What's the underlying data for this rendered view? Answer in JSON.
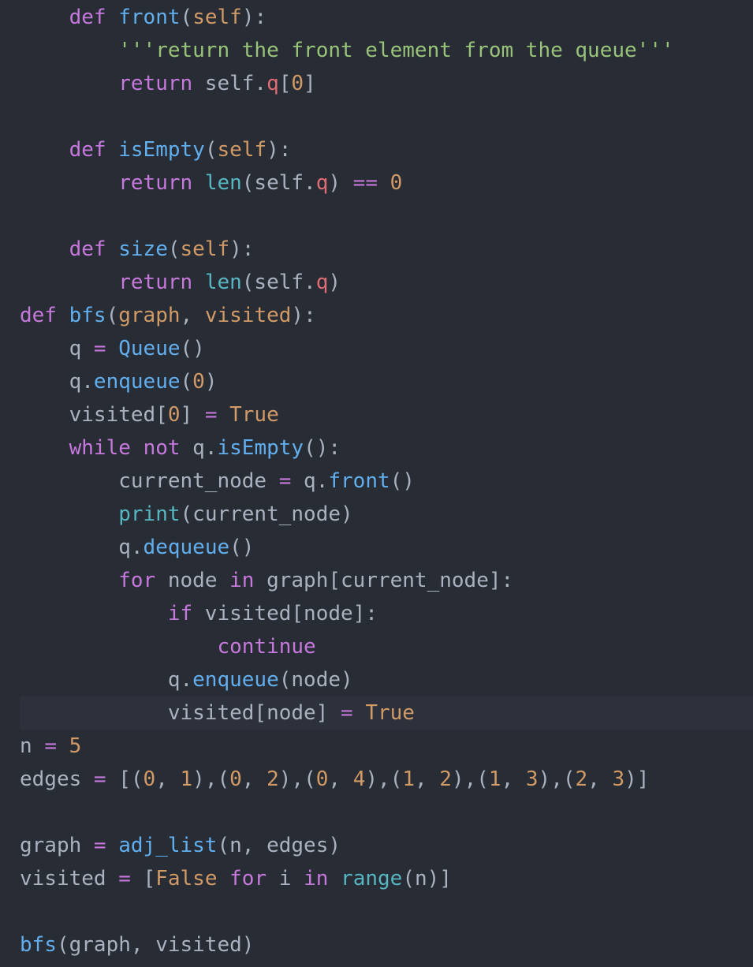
{
  "editor": {
    "language": "python",
    "theme": "one-dark",
    "background_color": "#282c34",
    "active_line_color": "#2c313c",
    "default_text_color": "#abb2bf",
    "font_size_px": 26,
    "line_height_px": 42,
    "active_line_number": 18,
    "palette": {
      "keyword": "#c678dd",
      "function": "#61afef",
      "parameter": "#d19a66",
      "builtin": "#56b6c2",
      "number": "#d19a66",
      "constant": "#d19a66",
      "string": "#98c379",
      "attribute": "#e06c75",
      "operator": "#c678dd",
      "plain": "#abb2bf"
    }
  },
  "code": {
    "lines": [
      {
        "n": 1,
        "text": "    def front(self):",
        "tokens": [
          {
            "t": "    ",
            "c": "plain"
          },
          {
            "t": "def",
            "c": "keyword"
          },
          {
            "t": " ",
            "c": "plain"
          },
          {
            "t": "front",
            "c": "function"
          },
          {
            "t": "(",
            "c": "plain"
          },
          {
            "t": "self",
            "c": "parameter"
          },
          {
            "t": "):",
            "c": "plain"
          }
        ]
      },
      {
        "n": 2,
        "text": "        '''return the front element from the queue'''",
        "tokens": [
          {
            "t": "        ",
            "c": "plain"
          },
          {
            "t": "'''return the front element from the queue'''",
            "c": "string"
          }
        ]
      },
      {
        "n": 3,
        "text": "        return self.q[0]",
        "tokens": [
          {
            "t": "        ",
            "c": "plain"
          },
          {
            "t": "return",
            "c": "keyword"
          },
          {
            "t": " self.",
            "c": "plain"
          },
          {
            "t": "q",
            "c": "attribute"
          },
          {
            "t": "[",
            "c": "plain"
          },
          {
            "t": "0",
            "c": "number"
          },
          {
            "t": "]",
            "c": "plain"
          }
        ]
      },
      {
        "n": 4,
        "text": "",
        "tokens": []
      },
      {
        "n": 5,
        "text": "    def isEmpty(self):",
        "tokens": [
          {
            "t": "    ",
            "c": "plain"
          },
          {
            "t": "def",
            "c": "keyword"
          },
          {
            "t": " ",
            "c": "plain"
          },
          {
            "t": "isEmpty",
            "c": "function"
          },
          {
            "t": "(",
            "c": "plain"
          },
          {
            "t": "self",
            "c": "parameter"
          },
          {
            "t": "):",
            "c": "plain"
          }
        ]
      },
      {
        "n": 6,
        "text": "        return len(self.q) == 0",
        "tokens": [
          {
            "t": "        ",
            "c": "plain"
          },
          {
            "t": "return",
            "c": "keyword"
          },
          {
            "t": " ",
            "c": "plain"
          },
          {
            "t": "len",
            "c": "builtin"
          },
          {
            "t": "(self.",
            "c": "plain"
          },
          {
            "t": "q",
            "c": "attribute"
          },
          {
            "t": ") ",
            "c": "plain"
          },
          {
            "t": "==",
            "c": "operator"
          },
          {
            "t": " ",
            "c": "plain"
          },
          {
            "t": "0",
            "c": "number"
          }
        ]
      },
      {
        "n": 7,
        "text": "",
        "tokens": []
      },
      {
        "n": 8,
        "text": "    def size(self):",
        "tokens": [
          {
            "t": "    ",
            "c": "plain"
          },
          {
            "t": "def",
            "c": "keyword"
          },
          {
            "t": " ",
            "c": "plain"
          },
          {
            "t": "size",
            "c": "function"
          },
          {
            "t": "(",
            "c": "plain"
          },
          {
            "t": "self",
            "c": "parameter"
          },
          {
            "t": "):",
            "c": "plain"
          }
        ]
      },
      {
        "n": 9,
        "text": "        return len(self.q)",
        "tokens": [
          {
            "t": "        ",
            "c": "plain"
          },
          {
            "t": "return",
            "c": "keyword"
          },
          {
            "t": " ",
            "c": "plain"
          },
          {
            "t": "len",
            "c": "builtin"
          },
          {
            "t": "(self.",
            "c": "plain"
          },
          {
            "t": "q",
            "c": "attribute"
          },
          {
            "t": ")",
            "c": "plain"
          }
        ]
      },
      {
        "n": 10,
        "text": "def bfs(graph, visited):",
        "tokens": [
          {
            "t": "def",
            "c": "keyword"
          },
          {
            "t": " ",
            "c": "plain"
          },
          {
            "t": "bfs",
            "c": "function"
          },
          {
            "t": "(",
            "c": "plain"
          },
          {
            "t": "graph",
            "c": "parameter"
          },
          {
            "t": ", ",
            "c": "plain"
          },
          {
            "t": "visited",
            "c": "parameter"
          },
          {
            "t": "):",
            "c": "plain"
          }
        ]
      },
      {
        "n": 11,
        "text": "    q = Queue()",
        "tokens": [
          {
            "t": "    q ",
            "c": "plain"
          },
          {
            "t": "=",
            "c": "operator"
          },
          {
            "t": " ",
            "c": "plain"
          },
          {
            "t": "Queue",
            "c": "function"
          },
          {
            "t": "()",
            "c": "plain"
          }
        ]
      },
      {
        "n": 12,
        "text": "    q.enqueue(0)",
        "tokens": [
          {
            "t": "    q.",
            "c": "plain"
          },
          {
            "t": "enqueue",
            "c": "function"
          },
          {
            "t": "(",
            "c": "plain"
          },
          {
            "t": "0",
            "c": "number"
          },
          {
            "t": ")",
            "c": "plain"
          }
        ]
      },
      {
        "n": 13,
        "text": "    visited[0] = True",
        "tokens": [
          {
            "t": "    visited[",
            "c": "plain"
          },
          {
            "t": "0",
            "c": "number"
          },
          {
            "t": "] ",
            "c": "plain"
          },
          {
            "t": "=",
            "c": "operator"
          },
          {
            "t": " ",
            "c": "plain"
          },
          {
            "t": "True",
            "c": "constant"
          }
        ]
      },
      {
        "n": 14,
        "text": "    while not q.isEmpty():",
        "tokens": [
          {
            "t": "    ",
            "c": "plain"
          },
          {
            "t": "while",
            "c": "keyword"
          },
          {
            "t": " ",
            "c": "plain"
          },
          {
            "t": "not",
            "c": "keyword"
          },
          {
            "t": " q.",
            "c": "plain"
          },
          {
            "t": "isEmpty",
            "c": "function"
          },
          {
            "t": "():",
            "c": "plain"
          }
        ]
      },
      {
        "n": 15,
        "text": "        current_node = q.front()",
        "tokens": [
          {
            "t": "        current_node ",
            "c": "plain"
          },
          {
            "t": "=",
            "c": "operator"
          },
          {
            "t": " q.",
            "c": "plain"
          },
          {
            "t": "front",
            "c": "function"
          },
          {
            "t": "()",
            "c": "plain"
          }
        ]
      },
      {
        "n": 16,
        "text": "        print(current_node)",
        "tokens": [
          {
            "t": "        ",
            "c": "plain"
          },
          {
            "t": "print",
            "c": "builtin"
          },
          {
            "t": "(current_node)",
            "c": "plain"
          }
        ]
      },
      {
        "n": 17,
        "text": "        q.dequeue()",
        "tokens": [
          {
            "t": "        q.",
            "c": "plain"
          },
          {
            "t": "dequeue",
            "c": "function"
          },
          {
            "t": "()",
            "c": "plain"
          }
        ]
      },
      {
        "n": 18,
        "text": "        for node in graph[current_node]:",
        "tokens": [
          {
            "t": "        ",
            "c": "plain"
          },
          {
            "t": "for",
            "c": "keyword"
          },
          {
            "t": " node ",
            "c": "plain"
          },
          {
            "t": "in",
            "c": "keyword"
          },
          {
            "t": " graph[current_node]:",
            "c": "plain"
          }
        ]
      },
      {
        "n": 19,
        "text": "            if visited[node]:",
        "tokens": [
          {
            "t": "            ",
            "c": "plain"
          },
          {
            "t": "if",
            "c": "keyword"
          },
          {
            "t": " visited[node]:",
            "c": "plain"
          }
        ]
      },
      {
        "n": 20,
        "text": "                continue",
        "tokens": [
          {
            "t": "                ",
            "c": "plain"
          },
          {
            "t": "continue",
            "c": "keyword"
          }
        ]
      },
      {
        "n": 21,
        "text": "            q.enqueue(node)",
        "tokens": [
          {
            "t": "            q.",
            "c": "plain"
          },
          {
            "t": "enqueue",
            "c": "function"
          },
          {
            "t": "(node)",
            "c": "plain"
          }
        ]
      },
      {
        "n": 22,
        "active": true,
        "text": "            visited[node] = True",
        "tokens": [
          {
            "t": "            visited[node] ",
            "c": "plain"
          },
          {
            "t": "=",
            "c": "operator"
          },
          {
            "t": " ",
            "c": "plain"
          },
          {
            "t": "True",
            "c": "constant"
          }
        ]
      },
      {
        "n": 23,
        "text": "n = 5",
        "tokens": [
          {
            "t": "n ",
            "c": "plain"
          },
          {
            "t": "=",
            "c": "operator"
          },
          {
            "t": " ",
            "c": "plain"
          },
          {
            "t": "5",
            "c": "number"
          }
        ]
      },
      {
        "n": 24,
        "text": "edges = [(0, 1),(0, 2),(0, 4),(1, 2),(1, 3),(2, 3)]",
        "tokens": [
          {
            "t": "edges ",
            "c": "plain"
          },
          {
            "t": "=",
            "c": "operator"
          },
          {
            "t": " [(",
            "c": "plain"
          },
          {
            "t": "0",
            "c": "number"
          },
          {
            "t": ", ",
            "c": "plain"
          },
          {
            "t": "1",
            "c": "number"
          },
          {
            "t": "),(",
            "c": "plain"
          },
          {
            "t": "0",
            "c": "number"
          },
          {
            "t": ", ",
            "c": "plain"
          },
          {
            "t": "2",
            "c": "number"
          },
          {
            "t": "),(",
            "c": "plain"
          },
          {
            "t": "0",
            "c": "number"
          },
          {
            "t": ", ",
            "c": "plain"
          },
          {
            "t": "4",
            "c": "number"
          },
          {
            "t": "),(",
            "c": "plain"
          },
          {
            "t": "1",
            "c": "number"
          },
          {
            "t": ", ",
            "c": "plain"
          },
          {
            "t": "2",
            "c": "number"
          },
          {
            "t": "),(",
            "c": "plain"
          },
          {
            "t": "1",
            "c": "number"
          },
          {
            "t": ", ",
            "c": "plain"
          },
          {
            "t": "3",
            "c": "number"
          },
          {
            "t": "),(",
            "c": "plain"
          },
          {
            "t": "2",
            "c": "number"
          },
          {
            "t": ", ",
            "c": "plain"
          },
          {
            "t": "3",
            "c": "number"
          },
          {
            "t": ")]",
            "c": "plain"
          }
        ]
      },
      {
        "n": 25,
        "text": "",
        "tokens": []
      },
      {
        "n": 26,
        "text": "graph = adj_list(n, edges)",
        "tokens": [
          {
            "t": "graph ",
            "c": "plain"
          },
          {
            "t": "=",
            "c": "operator"
          },
          {
            "t": " ",
            "c": "plain"
          },
          {
            "t": "adj_list",
            "c": "function"
          },
          {
            "t": "(n, edges)",
            "c": "plain"
          }
        ]
      },
      {
        "n": 27,
        "text": "visited = [False for i in range(n)]",
        "tokens": [
          {
            "t": "visited ",
            "c": "plain"
          },
          {
            "t": "=",
            "c": "operator"
          },
          {
            "t": " [",
            "c": "plain"
          },
          {
            "t": "False",
            "c": "constant"
          },
          {
            "t": " ",
            "c": "plain"
          },
          {
            "t": "for",
            "c": "keyword"
          },
          {
            "t": " i ",
            "c": "plain"
          },
          {
            "t": "in",
            "c": "keyword"
          },
          {
            "t": " ",
            "c": "plain"
          },
          {
            "t": "range",
            "c": "builtin"
          },
          {
            "t": "(n)]",
            "c": "plain"
          }
        ]
      },
      {
        "n": 28,
        "text": "",
        "tokens": []
      },
      {
        "n": 29,
        "text": "bfs(graph, visited)",
        "tokens": [
          {
            "t": "bfs",
            "c": "function"
          },
          {
            "t": "(graph, visited)",
            "c": "plain"
          }
        ]
      }
    ]
  }
}
